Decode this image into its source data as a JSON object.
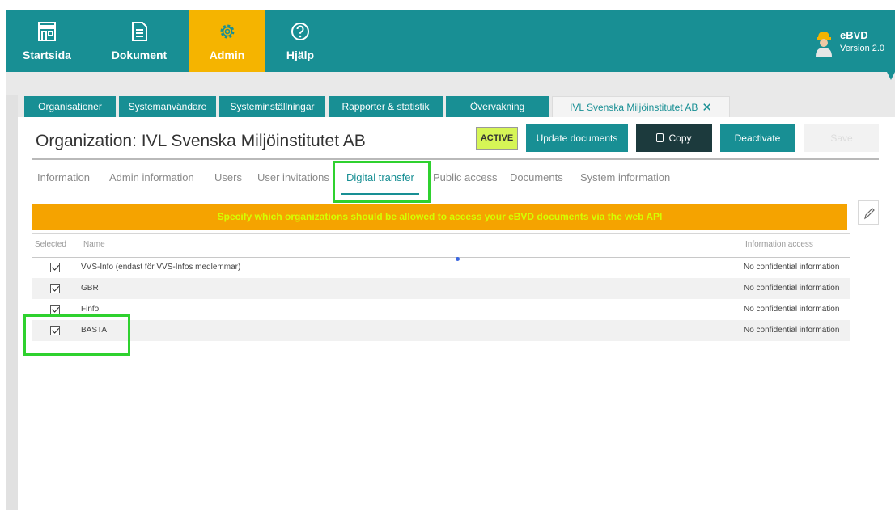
{
  "nav": {
    "items": [
      {
        "label": "Startsida",
        "icon": "home-icon"
      },
      {
        "label": "Dokument",
        "icon": "document-icon"
      },
      {
        "label": "Admin",
        "icon": "gear-icon",
        "active": true
      },
      {
        "label": "Hjälp",
        "icon": "help-icon"
      }
    ],
    "brand": {
      "name": "eBVD",
      "version": "Version 2.0",
      "icon": "worker-avatar-icon"
    }
  },
  "main_tabs": [
    {
      "label": "Organisationer"
    },
    {
      "label": "Systemanvändare"
    },
    {
      "label": "Systeminställningar"
    },
    {
      "label": "Rapporter & statistik"
    },
    {
      "label": "Övervakning"
    },
    {
      "label": "IVL Svenska Miljöinstitutet AB",
      "closable": true,
      "active": true
    }
  ],
  "page": {
    "title": "Organization: IVL Svenska Miljöinstitutet AB",
    "status": "ACTIVE",
    "buttons": {
      "update": "Update documents",
      "copy": "Copy",
      "deactivate": "Deactivate",
      "save": "Save"
    }
  },
  "subtabs": [
    {
      "label": "Information"
    },
    {
      "label": "Admin information"
    },
    {
      "label": "Users"
    },
    {
      "label": "User invitations"
    },
    {
      "label": "Digital transfer",
      "active": true
    },
    {
      "label": "Public access"
    },
    {
      "label": "Documents"
    },
    {
      "label": "System information"
    }
  ],
  "banner": "Specify which organizations should be allowed to access your eBVD documents via the web API",
  "table": {
    "headers": {
      "selected": "Selected",
      "name": "Name",
      "access": "Information access"
    },
    "rows": [
      {
        "selected": true,
        "name": "VVS-Info (endast för VVS-Infos medlemmar)",
        "access": "No confidential information"
      },
      {
        "selected": true,
        "name": "GBR",
        "access": "No confidential information"
      },
      {
        "selected": true,
        "name": "Finfo",
        "access": "No confidential information"
      },
      {
        "selected": true,
        "name": "BASTA",
        "access": "No confidential information"
      }
    ]
  },
  "colors": {
    "teal": "#188f94",
    "admin_yellow": "#f5b400",
    "banner_orange": "#f5a300",
    "banner_text": "#d4ff00",
    "active_badge": "#d6f556",
    "highlight_green": "#2fd12f"
  }
}
